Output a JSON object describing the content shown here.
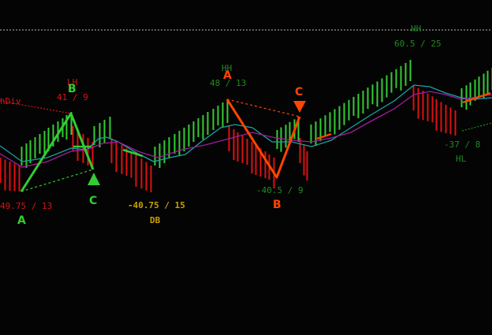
{
  "chart_data": {
    "type": "ohlc",
    "bars_up_color": "#33cc33",
    "bars_down_color": "#dd1111",
    "ma_fast_color": "#1aa3a3",
    "ma_slow_color": "#a01ca0",
    "pattern_green_color": "#33cc33",
    "pattern_orange_color": "#ff4500",
    "reference_line": "dotted white line near top",
    "labels": [
      {
        "id": "hdiv",
        "text": "hDiv",
        "color": "#dd1111"
      },
      {
        "id": "lh1",
        "text": "LH",
        "color": "#dd1111"
      },
      {
        "id": "lh1_val",
        "text": "41 / 9",
        "color": "#dd1111"
      },
      {
        "id": "B1",
        "text": "B",
        "color": "#33cc33"
      },
      {
        "id": "A1_val",
        "text": "49.75 / 13",
        "color": "#dd1111"
      },
      {
        "id": "A1",
        "text": "A",
        "color": "#33cc33"
      },
      {
        "id": "C1",
        "text": "C",
        "color": "#33cc33"
      },
      {
        "id": "db_val",
        "text": "-40.75 / 15",
        "color": "#c8a000"
      },
      {
        "id": "db",
        "text": "DB",
        "color": "#c8a000"
      },
      {
        "id": "hh1",
        "text": "HH",
        "color": "#1e8a1e"
      },
      {
        "id": "hh1_val",
        "text": "48 / 13",
        "color": "#1e8a1e"
      },
      {
        "id": "A2",
        "text": "A",
        "color": "#ff4500"
      },
      {
        "id": "C2",
        "text": "C",
        "color": "#ff4500"
      },
      {
        "id": "B2_val",
        "text": "-40.5 / 9",
        "color": "#1e8a1e"
      },
      {
        "id": "B2",
        "text": "B",
        "color": "#ff4500"
      },
      {
        "id": "hh2",
        "text": "HH",
        "color": "#1e8a1e"
      },
      {
        "id": "hh2_val",
        "text": "60.5 / 25",
        "color": "#1e8a1e"
      },
      {
        "id": "hl_val",
        "text": "-37 / 8",
        "color": "#1e8a1e"
      },
      {
        "id": "hl",
        "text": "HL",
        "color": "#1e8a1e"
      }
    ]
  }
}
